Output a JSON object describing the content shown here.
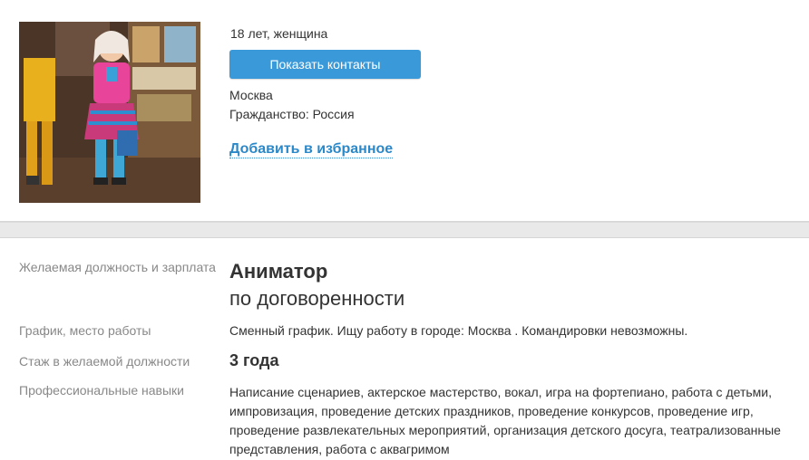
{
  "profile": {
    "age_gender": "18 лет, женщина",
    "show_contacts_label": "Показать контакты",
    "city": "Москва",
    "citizenship": "Гражданство: Россия",
    "add_favorite_label": "Добавить в избранное",
    "photo_description": "Аниматор в костюме"
  },
  "resume": {
    "position_label": "Желаемая должность и зарплата",
    "position_title": "Аниматор",
    "salary": "по договоренности",
    "schedule_label": "График, место работы",
    "schedule_value": "Сменный график. Ищу работу в городе: Москва . Командировки невозможны.",
    "experience_label": "Стаж в желаемой должности",
    "experience_value": "3 года",
    "skills_label": "Профессиональные навыки",
    "skills_value": "Написание сценариев, актерское мастерство, вокал, игра на фортепиано, работа с детьми, импровизация, проведение детских праздников, проведение конкурсов, проведение игр, проведение развлекательных мероприятий, организация детского досуга, театрализованные представления, работа с аквагримом"
  },
  "colors": {
    "button": "#3a9ad9",
    "link": "#2b88c9",
    "label": "#888888"
  }
}
